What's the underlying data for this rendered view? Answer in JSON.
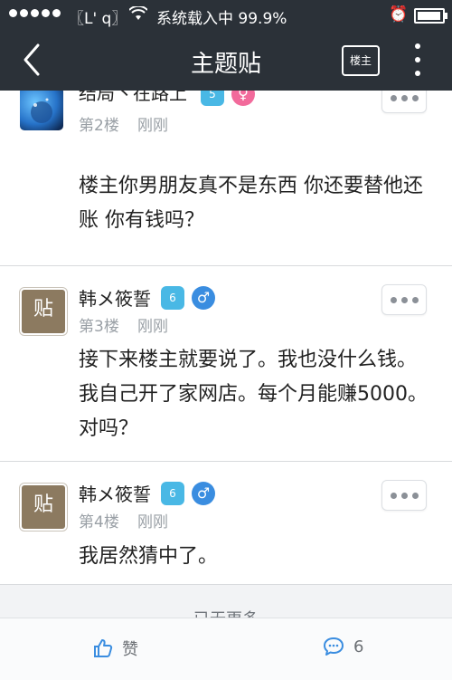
{
  "status_bar": {
    "carrier": "〖L' q〗",
    "status_text": "系统载入中 99.9%"
  },
  "nav": {
    "title": "主题贴",
    "louzhu_label": "楼主"
  },
  "posts": [
    {
      "username": "结局丶在路上",
      "level": "5",
      "gender": "female",
      "gender_symbol": "♀",
      "floor": "第2楼",
      "time": "刚刚",
      "text": "楼主你男朋友真不是东西 你还要替他还账 你有钱吗？"
    },
    {
      "username": "韩メ筱誓",
      "level": "6",
      "gender": "male",
      "gender_symbol": "♂",
      "floor": "第3楼",
      "time": "刚刚",
      "avatar_text": "贴",
      "text": "接下来楼主就要说了。我也没什么钱。我自己开了家网店。每个月能赚5000。对吗？"
    },
    {
      "username": "韩メ筱誓",
      "level": "6",
      "gender": "male",
      "gender_symbol": "♂",
      "floor": "第4楼",
      "time": "刚刚",
      "avatar_text": "贴",
      "text": "我居然猜中了。"
    }
  ],
  "load_more": "已无更多",
  "bottom_bar": {
    "like_label": "赞",
    "comment_count": "6"
  },
  "colors": {
    "nav_bg": "#2b3138",
    "level_badge": "#49b8e5",
    "female": "#f26a9b",
    "male": "#3a8de0",
    "action_icon": "#3a8de0"
  }
}
